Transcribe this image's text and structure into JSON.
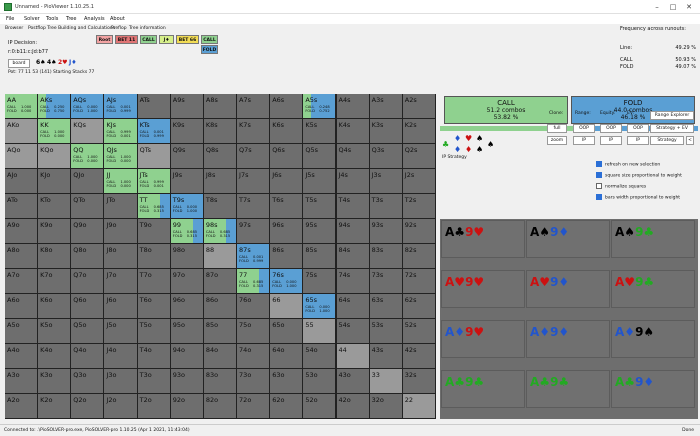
{
  "window": {
    "title": "Unnamed - PioViewer 1.10.25.1",
    "minimize": "–",
    "maximize": "□",
    "close": "✕"
  },
  "menu": [
    "File",
    "Solver",
    "Tools",
    "Tree",
    "Analysis",
    "About"
  ],
  "tabs": [
    "Browser",
    "Postflop Tree Building and Calculations",
    "Preflop",
    "Tree information"
  ],
  "info": {
    "decision": "IP Decision:",
    "board_line": "r:0:b11:c:Jd:b77",
    "board_button": "board",
    "board_cards": [
      "6♠",
      "4♠",
      "2♥",
      "J♦"
    ],
    "pot": "Pot: 77 11 53 (141) Starting Stacks 77"
  },
  "sequence": {
    "row1": [
      "Root",
      "BET 11",
      "CALL",
      "J♦",
      "BET 66",
      "CALL"
    ],
    "row2": [
      "FOLD"
    ]
  },
  "freq": {
    "title": "Frequency across runouts:",
    "line_label": "Line:",
    "line_value": "49.29 %",
    "call_label": "CALL",
    "call_value": "50.93 %",
    "fold_label": "FOLD",
    "fold_value": "49.07 %"
  },
  "colors": {
    "call": "#8fd18f",
    "fold": "#5a9fd4",
    "empty": "#6e6e6e",
    "grid_bg": "#222222"
  },
  "grid": [
    [
      "AA",
      "AKs",
      "AQs",
      "AJs",
      "ATs",
      "A9s",
      "A8s",
      "A7s",
      "A6s",
      "A5s",
      "A4s",
      "A3s",
      "A2s"
    ],
    [
      "AKo",
      "KK",
      "KQs",
      "KJs",
      "KTs",
      "K9s",
      "K8s",
      "K7s",
      "K6s",
      "K5s",
      "K4s",
      "K3s",
      "K2s"
    ],
    [
      "AQo",
      "KQo",
      "QQ",
      "QJs",
      "QTs",
      "Q9s",
      "Q8s",
      "Q7s",
      "Q6s",
      "Q5s",
      "Q4s",
      "Q3s",
      "Q2s"
    ],
    [
      "AJo",
      "KJo",
      "QJo",
      "JJ",
      "JTs",
      "J9s",
      "J8s",
      "J7s",
      "J6s",
      "J5s",
      "J4s",
      "J3s",
      "J2s"
    ],
    [
      "ATo",
      "KTo",
      "QTo",
      "JTo",
      "TT",
      "T9s",
      "T8s",
      "T7s",
      "T6s",
      "T5s",
      "T4s",
      "T3s",
      "T2s"
    ],
    [
      "A9o",
      "K9o",
      "Q9o",
      "J9o",
      "T9o",
      "99",
      "98s",
      "97s",
      "96s",
      "95s",
      "94s",
      "93s",
      "92s"
    ],
    [
      "A8o",
      "K8o",
      "Q8o",
      "J8o",
      "T8o",
      "98o",
      "88",
      "87s",
      "86s",
      "85s",
      "84s",
      "83s",
      "82s"
    ],
    [
      "A7o",
      "K7o",
      "Q7o",
      "J7o",
      "T7o",
      "97o",
      "87o",
      "77",
      "76s",
      "75s",
      "74s",
      "73s",
      "72s"
    ],
    [
      "A6o",
      "K6o",
      "Q6o",
      "J6o",
      "T6o",
      "96o",
      "86o",
      "76o",
      "66",
      "65s",
      "64s",
      "63s",
      "62s"
    ],
    [
      "A5o",
      "K5o",
      "Q5o",
      "J5o",
      "T5o",
      "95o",
      "85o",
      "75o",
      "65o",
      "55",
      "54s",
      "53s",
      "52s"
    ],
    [
      "A4o",
      "K4o",
      "Q4o",
      "J4o",
      "T4o",
      "94o",
      "84o",
      "74o",
      "64o",
      "54o",
      "44",
      "43s",
      "42s"
    ],
    [
      "A3o",
      "K3o",
      "Q3o",
      "J3o",
      "T3o",
      "93o",
      "83o",
      "73o",
      "63o",
      "53o",
      "43o",
      "33",
      "32s"
    ],
    [
      "A2o",
      "K2o",
      "Q2o",
      "J2o",
      "T2o",
      "92o",
      "82o",
      "72o",
      "62o",
      "52o",
      "42o",
      "32o",
      "22"
    ]
  ],
  "cells": [
    {
      "hand": "AA",
      "call": "1.000",
      "fold": "0.000",
      "call_frac": 1.0
    },
    {
      "hand": "AKs",
      "call": "0.250",
      "fold": "0.750",
      "call_frac": 0.25
    },
    {
      "hand": "AQs",
      "call": "0.000",
      "fold": "1.000",
      "call_frac": 0.0
    },
    {
      "hand": "AJs",
      "call": "0.001",
      "fold": "0.999",
      "call_frac": 0.001
    },
    {
      "hand": "A5s",
      "call": "0.248",
      "fold": "0.752",
      "call_frac": 0.248
    },
    {
      "hand": "KK",
      "call": "1.000",
      "fold": "0.000",
      "call_frac": 1.0
    },
    {
      "hand": "KJs",
      "call": "0.999",
      "fold": "0.001",
      "call_frac": 0.999
    },
    {
      "hand": "KTs",
      "call": "0.001",
      "fold": "0.999",
      "call_frac": 0.001
    },
    {
      "hand": "QQ",
      "call": "1.000",
      "fold": "0.000",
      "call_frac": 1.0
    },
    {
      "hand": "QJs",
      "call": "1.000",
      "fold": "0.000",
      "call_frac": 1.0
    },
    {
      "hand": "JJ",
      "call": "1.000",
      "fold": "0.000",
      "call_frac": 1.0
    },
    {
      "hand": "JTs",
      "call": "0.999",
      "fold": "0.001",
      "call_frac": 0.999
    },
    {
      "hand": "TT",
      "call": "0.685",
      "fold": "0.315",
      "call_frac": 0.685
    },
    {
      "hand": "T9s",
      "call": "0.000",
      "fold": "1.000",
      "call_frac": 0.0
    },
    {
      "hand": "99",
      "call": "0.685",
      "fold": "0.315",
      "call_frac": 0.685
    },
    {
      "hand": "98s",
      "call": "0.685",
      "fold": "0.315",
      "call_frac": 0.685
    },
    {
      "hand": "87s",
      "call": "0.001",
      "fold": "0.999",
      "call_frac": 0.001
    },
    {
      "hand": "77",
      "call": "0.685",
      "fold": "0.315",
      "call_frac": 0.685
    },
    {
      "hand": "76s",
      "call": "0.000",
      "fold": "1.000",
      "call_frac": 0.0
    },
    {
      "hand": "65s",
      "call": "0.000",
      "fold": "1.000",
      "call_frac": 0.0
    }
  ],
  "inrange": [
    "AA",
    "AKs",
    "AQs",
    "AJs",
    "A5s",
    "AKo",
    "KK",
    "KQs",
    "KJs",
    "KTs",
    "AQo",
    "KQo",
    "QQ",
    "QJs",
    "QTs",
    "JJ",
    "JTs",
    "TT",
    "T9s",
    "99",
    "98s",
    "88",
    "87s",
    "77",
    "76s",
    "66",
    "65s",
    "55",
    "44",
    "33",
    "22"
  ],
  "summary": {
    "call_title": "CALL",
    "call_combos": "51.2 combos",
    "call_pct": "53.82 %",
    "call_frac": 0.5382,
    "fold_title": "FOLD",
    "fold_combos": "44.0 combos",
    "fold_pct": "46.18 %"
  },
  "controls": {
    "clone": "Clone:",
    "range": "Range:",
    "equity": "Equity:",
    "ev": "EV:",
    "full": "full",
    "zoom": "zoom",
    "oop1": "OOP",
    "ip1": "IP",
    "oop2": "OOP",
    "ip2": "IP",
    "oop3": "OOP",
    "ip3": "IP",
    "range_explorer": "Range Explorer",
    "strategy_ev": "Strategy + EV",
    "strategy": "Strategy",
    "left_arrow": "<",
    "ip_strategy": "IP Strategy"
  },
  "checkboxes": [
    {
      "label": "refresh on new selection",
      "checked": true
    },
    {
      "label": "square size proportional to weight",
      "checked": true
    },
    {
      "label": "normalize squares",
      "checked": false
    },
    {
      "label": "bars width proportional to weight",
      "checked": true
    }
  ],
  "combos": [
    [
      {
        "r1": "A",
        "s1": "♣",
        "r2": "9",
        "s2": "♥",
        "c1": "#000",
        "c2": "#cc1111"
      },
      {
        "r1": "A",
        "s1": "♠",
        "r2": "9",
        "s2": "♦",
        "c1": "#000",
        "c2": "#2255cc"
      },
      {
        "r1": "A",
        "s1": "♠",
        "r2": "9",
        "s2": "♣",
        "c1": "#000",
        "c2": "#22aa22"
      }
    ],
    [
      {
        "r1": "A",
        "s1": "♥",
        "r2": "9",
        "s2": "♥",
        "c1": "#cc1111",
        "c2": "#cc1111"
      },
      {
        "r1": "A",
        "s1": "♥",
        "r2": "9",
        "s2": "♦",
        "c1": "#cc1111",
        "c2": "#2255cc"
      },
      {
        "r1": "A",
        "s1": "♥",
        "r2": "9",
        "s2": "♣",
        "c1": "#cc1111",
        "c2": "#22aa22"
      }
    ],
    [
      {
        "r1": "A",
        "s1": "♦",
        "r2": "9",
        "s2": "♥",
        "c1": "#2255cc",
        "c2": "#cc1111"
      },
      {
        "r1": "A",
        "s1": "♦",
        "r2": "9",
        "s2": "♦",
        "c1": "#2255cc",
        "c2": "#2255cc"
      },
      {
        "r1": "A",
        "s1": "♦",
        "r2": "9",
        "s2": "♠",
        "c1": "#2255cc",
        "c2": "#000"
      }
    ],
    [
      {
        "r1": "A",
        "s1": "♣",
        "r2": "9",
        "s2": "♣",
        "c1": "#22aa22",
        "c2": "#22aa22"
      },
      {
        "r1": "A",
        "s1": "♣",
        "r2": "9",
        "s2": "♣",
        "c1": "#22aa22",
        "c2": "#22aa22"
      },
      {
        "r1": "A",
        "s1": "♣",
        "r2": "9",
        "s2": "♦",
        "c1": "#22aa22",
        "c2": "#2255cc"
      }
    ]
  ],
  "status": {
    "left": "Connected to: .\\PioSOLVER-pro.exe, PioSOLVER-pro 1.10.25 (Apr 1 2021, 11:43:04)",
    "right": "Done"
  }
}
